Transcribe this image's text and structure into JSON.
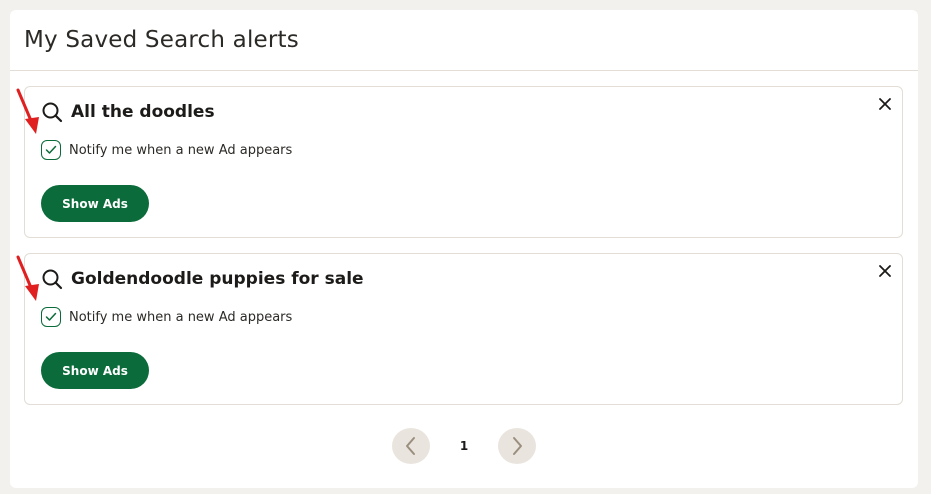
{
  "page": {
    "title": "My Saved Search alerts"
  },
  "alerts": [
    {
      "title": "All the doodles",
      "notify_label": "Notify me when a new Ad appears",
      "notify_checked": true,
      "button_label": "Show Ads"
    },
    {
      "title": "Goldendoodle puppies for sale",
      "notify_label": "Notify me when a new Ad appears",
      "notify_checked": true,
      "button_label": "Show Ads"
    }
  ],
  "pagination": {
    "current_page": "1"
  },
  "icons": {
    "search": "search-icon",
    "close": "close-icon",
    "check": "check-icon",
    "annotation_arrow": "arrow-icon",
    "prev": "chevron-left-icon",
    "next": "chevron-right-icon"
  },
  "colors": {
    "primary_green": "#0b6b3a",
    "page_background": "#f3f1ee",
    "pagination_button": "#e9e4dd",
    "annotation_red": "#e02020"
  }
}
